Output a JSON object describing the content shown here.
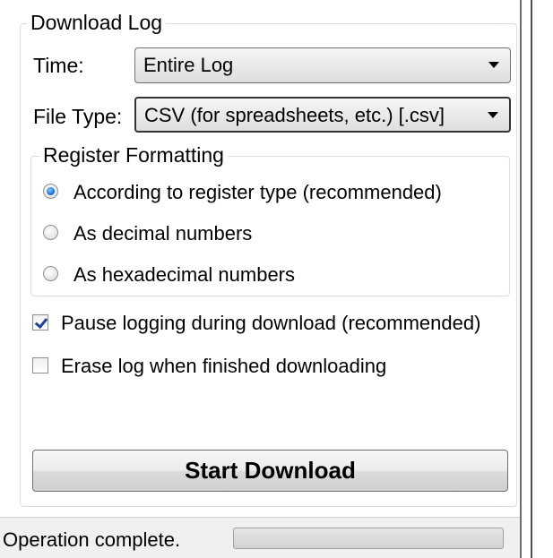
{
  "download_log": {
    "group_title": "Download Log",
    "time": {
      "label": "Time:",
      "selected": "Entire Log"
    },
    "file_type": {
      "label": "File Type:",
      "selected": "CSV (for spreadsheets, etc.) [.csv]"
    },
    "register_formatting": {
      "title": "Register Formatting",
      "options": [
        {
          "label": "According to register type (recommended)",
          "checked": true
        },
        {
          "label": "As decimal numbers",
          "checked": false
        },
        {
          "label": "As hexadecimal numbers",
          "checked": false
        }
      ]
    },
    "pause_logging": {
      "label": "Pause logging during download (recommended)",
      "checked": true
    },
    "erase_log": {
      "label": "Erase log when finished downloading",
      "checked": false
    },
    "start_button": "Start Download"
  },
  "status": {
    "text": "Operation complete.",
    "progress": 0
  }
}
